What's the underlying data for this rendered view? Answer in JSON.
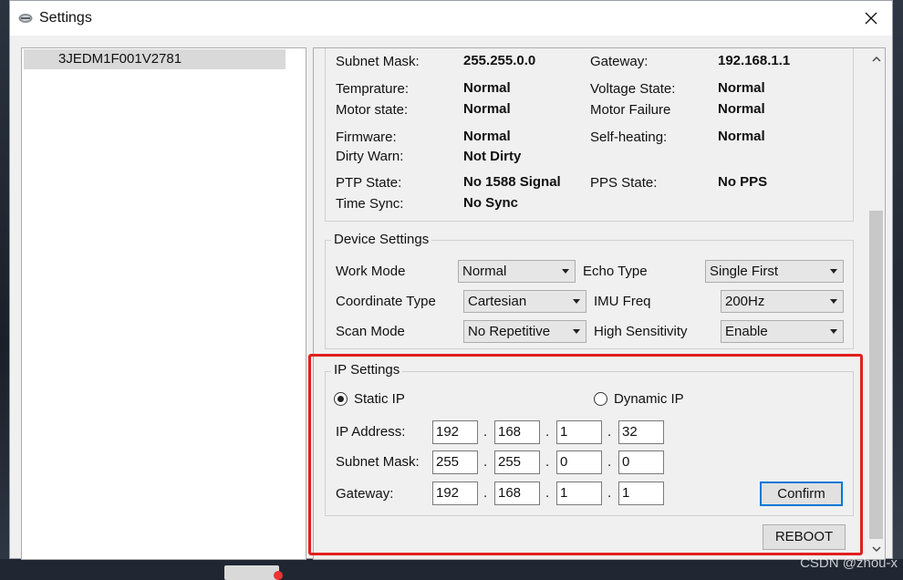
{
  "window": {
    "title": "Settings"
  },
  "device_list": [
    "3JEDM1F001V2781"
  ],
  "status": {
    "rows": [
      {
        "l1": "Subnet Mask:",
        "v1": "255.255.0.0",
        "l2": "Gateway:",
        "v2": "192.168.1.1"
      },
      {
        "l1": "Temprature:",
        "v1": "Normal",
        "l2": "Voltage State:",
        "v2": "Normal"
      },
      {
        "l1": "Motor state:",
        "v1": "Normal",
        "l2": "Motor Failure",
        "v2": "Normal"
      },
      {
        "l1": "Firmware:",
        "v1": "Normal",
        "l2": "Self-heating:",
        "v2": "Normal"
      },
      {
        "l1": "Dirty Warn:",
        "v1": "Not Dirty"
      },
      {
        "l1": "PTP State:",
        "v1": "No 1588 Signal",
        "l2": "PPS State:",
        "v2": "No PPS"
      },
      {
        "l1": "Time Sync:",
        "v1": "No Sync"
      }
    ]
  },
  "device_settings": {
    "title": "Device Settings",
    "work_mode": {
      "label": "Work Mode",
      "value": "Normal"
    },
    "echo_type": {
      "label": "Echo Type",
      "value": "Single First"
    },
    "coordinate_type": {
      "label": "Coordinate Type",
      "value": "Cartesian"
    },
    "imu_freq": {
      "label": "IMU Freq",
      "value": "200Hz"
    },
    "scan_mode": {
      "label": "Scan Mode",
      "value": "No Repetitive"
    },
    "high_sensitivity": {
      "label": "High Sensitivity",
      "value": "Enable"
    }
  },
  "ip_settings": {
    "title": "IP Settings",
    "static_label": "Static IP",
    "dynamic_label": "Dynamic IP",
    "selected": "static",
    "ip_label": "IP Address:",
    "ip": [
      "192",
      "168",
      "1",
      "32"
    ],
    "mask_label": "Subnet Mask:",
    "mask": [
      "255",
      "255",
      "0",
      "0"
    ],
    "gateway_label": "Gateway:",
    "gateway": [
      "192",
      "168",
      "1",
      "1"
    ],
    "separator": ".",
    "confirm_label": "Confirm"
  },
  "reboot_label": "REBOOT",
  "watermark": "CSDN @zhou-x",
  "colors": {
    "highlight_box": "#e0201c",
    "default_button_border": "#0078d7"
  }
}
